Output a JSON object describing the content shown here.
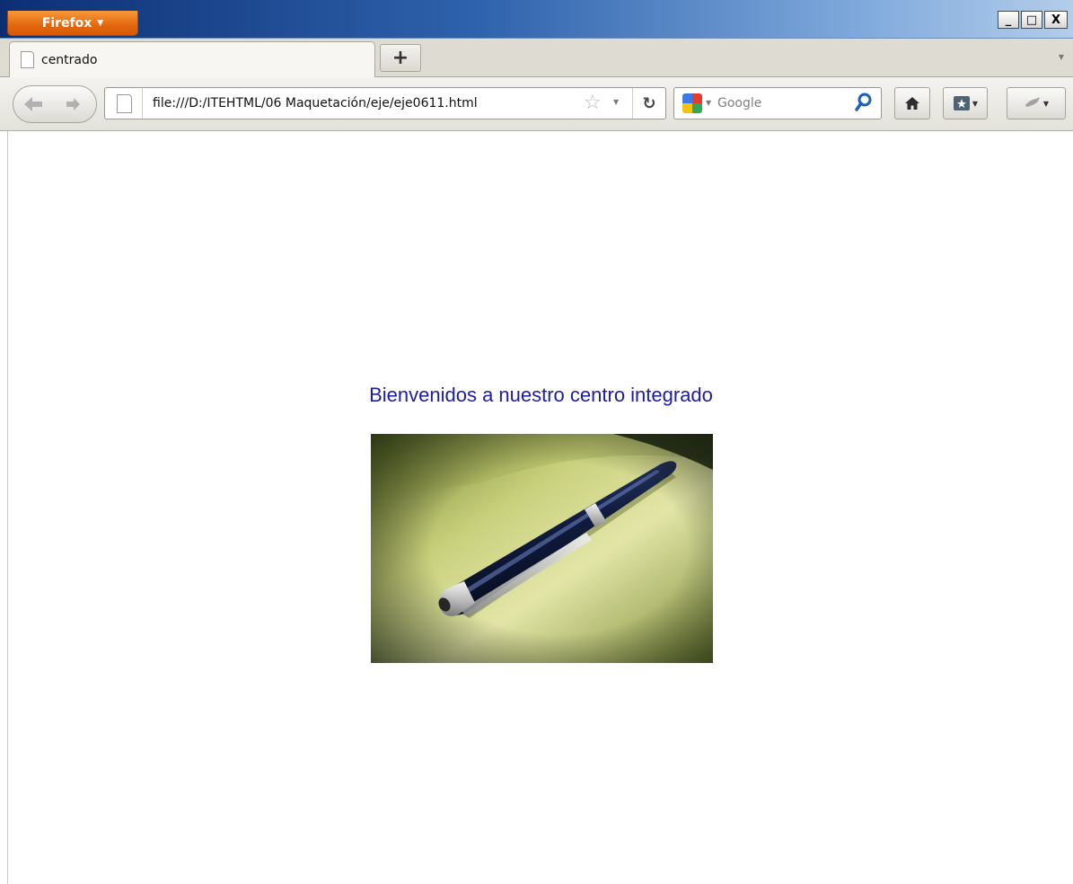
{
  "app": {
    "menu_button_label": "Firefox",
    "window_controls": {
      "minimize": "_",
      "maximize": "□",
      "close": "X"
    }
  },
  "tabs": [
    {
      "title": "centrado",
      "active": true
    }
  ],
  "new_tab_label": "+",
  "navigation": {
    "url": "file:///D:/ITEHTML/06 Maquetación/eje/eje0611.html",
    "search_placeholder": "Google",
    "search_engine_icon": "google-icon",
    "icons": [
      "back-arrow-icon",
      "forward-arrow-icon",
      "page-icon",
      "bookmark-star-icon",
      "reload-icon",
      "search-magnifier-icon",
      "home-icon",
      "bookmarks-icon",
      "addon-icon"
    ]
  },
  "page": {
    "heading": "Bienvenidos a nuestro centro integrado",
    "heading_color": "#1d1da3",
    "image_subject": "pen-on-paper-photo"
  },
  "colors": {
    "firefox_button": "#e4670d",
    "titlebar_start": "#0c2f74",
    "titlebar_end": "#b3cdea",
    "chrome_bg": "#dedbd3"
  }
}
